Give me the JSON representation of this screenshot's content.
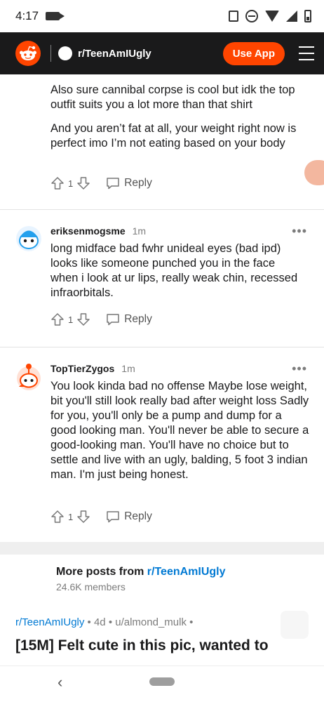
{
  "status_bar": {
    "time": "4:17"
  },
  "header": {
    "subreddit": "r/TeenAmIUgly",
    "use_app_label": "Use App"
  },
  "comments": [
    {
      "paragraphs": [
        "Also sure cannibal corpse is cool but idk the top outfit suits you a lot more than that shirt",
        "And you aren’t fat at all, your weight right now is perfect imo I’m not eating based on your body"
      ],
      "votes": "1",
      "reply_label": "Reply"
    },
    {
      "author": "eriksenmogsme",
      "age": "1m",
      "text": "long midface bad fwhr unideal eyes (bad ipd) looks like someone punched you in the face when i look at ur lips, really weak chin, recessed infraorbitals.",
      "votes": "1",
      "reply_label": "Reply"
    },
    {
      "author": "TopTierZygos",
      "age": "1m",
      "text": "You look kinda bad no offense Maybe lose weight, bit you'll still look really bad after weight loss Sadly for you, you'll only be a pump and dump for a good looking man. You'll never be able to secure a good-looking man. You'll have no choice but to settle and live with an ugly, balding, 5 foot 3 indian man. I'm just being honest.",
      "votes": "1",
      "reply_label": "Reply"
    }
  ],
  "more_posts": {
    "prefix": "More posts from",
    "subreddit": "r/TeenAmIUgly",
    "members": "24.6K members"
  },
  "next_post": {
    "subreddit": "r/TeenAmIUgly",
    "age": "4d",
    "user": "u/almond_mulk",
    "title": "[15M] Felt cute in this pic, wanted to"
  },
  "colors": {
    "brand": "#ff4500",
    "header_bg": "#1a1a1b",
    "link": "#0079d3"
  },
  "icons": [
    "reddit-logo-icon",
    "hamburger-menu-icon",
    "upvote-icon",
    "downvote-icon",
    "reply-icon",
    "more-options-icon",
    "back-icon"
  ]
}
